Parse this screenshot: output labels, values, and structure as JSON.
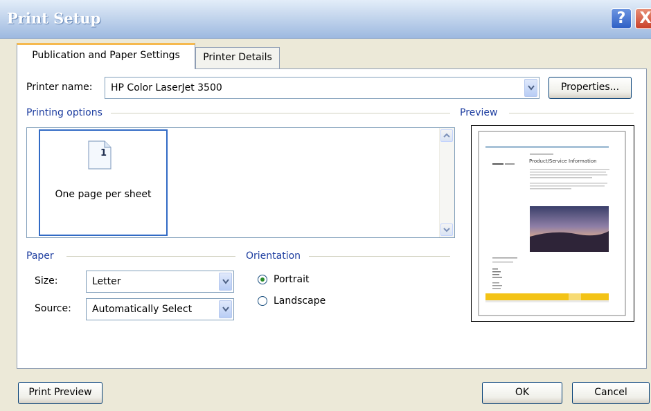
{
  "window": {
    "title": "Print Setup",
    "help_icon": "?",
    "close_icon": "X"
  },
  "tabs": [
    {
      "label": "Publication and Paper Settings",
      "active": true
    },
    {
      "label": "Printer Details",
      "active": false
    }
  ],
  "printer": {
    "name_label": "Printer name:",
    "name_value": "HP Color LaserJet 3500",
    "properties_button": "Properties..."
  },
  "printing_options": {
    "title": "Printing options",
    "selected_option": "One page per sheet",
    "page_number": "1"
  },
  "preview": {
    "title": "Preview",
    "doc_title": "Product/Service Information",
    "colors": {
      "accent_bar": "#A9C3D8",
      "footer_band": "#F3C316"
    }
  },
  "paper": {
    "title": "Paper",
    "size_label": "Size:",
    "size_value": "Letter",
    "source_label": "Source:",
    "source_value": "Automatically Select"
  },
  "orientation": {
    "title": "Orientation",
    "options": [
      {
        "label": "Portrait",
        "selected": true
      },
      {
        "label": "Landscape",
        "selected": false
      }
    ]
  },
  "buttons": {
    "print_preview": "Print Preview",
    "ok": "OK",
    "cancel": "Cancel"
  },
  "colors": {
    "titlebar_text": "#FFFFFF",
    "group_title": "#1E3EA0",
    "dialog_bg": "#ECE9D8",
    "selection_border": "#316AC5"
  }
}
